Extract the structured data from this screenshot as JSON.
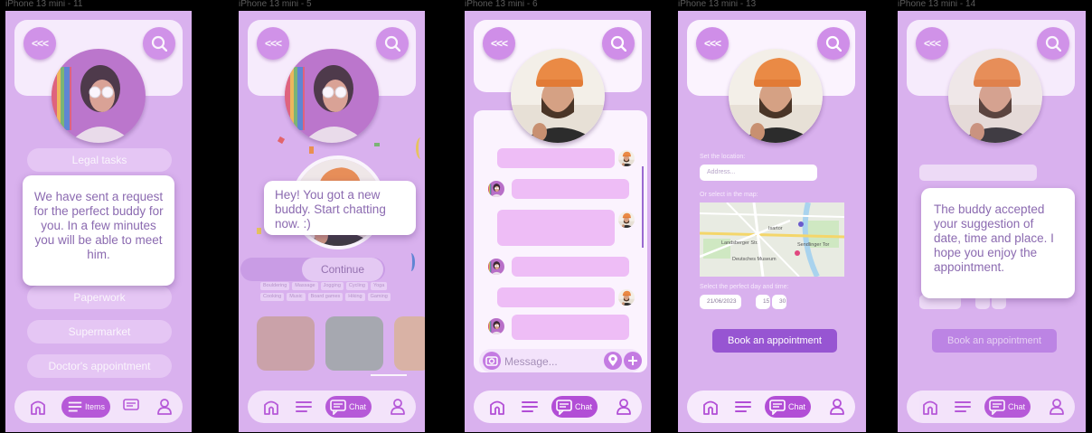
{
  "frames": [
    {
      "title": "iPhone 13 mini - 11"
    },
    {
      "title": "iPhone 13 mini - 5"
    },
    {
      "title": "iPhone 13 mini - 6"
    },
    {
      "title": "iPhone 13 mini - 13"
    },
    {
      "title": "iPhone 13 mini - 14"
    }
  ],
  "header": {
    "back_label": "<<<"
  },
  "screen1": {
    "pills": [
      "Legal tasks",
      "Paperwork",
      "Supermarket",
      "Doctor's appointment"
    ],
    "popup": "We have sent a request for the perfect buddy for you. In a few minutes you will be able to meet him.",
    "nav_active": "Items"
  },
  "screen2": {
    "popup": "Hey! You got a new buddy. Start chatting now. :)",
    "continue": "Continue",
    "tags": [
      "Bouldering",
      "Massage",
      "Jogging",
      "Cycling",
      "Yoga",
      "Cooking",
      "Music",
      "Board games",
      "Hiking",
      "Gaming"
    ],
    "nav_active": "Chat"
  },
  "screen3": {
    "message_placeholder": "Message...",
    "nav_active": "Chat"
  },
  "screen4": {
    "location_label": "Set the location:",
    "address_placeholder": "Address...",
    "map_label": "Or select in the map:",
    "map_places": [
      "Landsberger Str.",
      "Sendlinger Tor",
      "Isartor",
      "Deutsches Museum"
    ],
    "day_time_label": "Select the perfect day and time:",
    "date": "21/06/2023",
    "hour": "15",
    "minute": "30",
    "book_button": "Book an appointment",
    "nav_active": "Chat"
  },
  "screen5": {
    "popup": "The buddy accepted your suggestion of date, time and place. I hope you enjoy the appointment.",
    "book_button": "Book an appointment",
    "nav_active": "Chat"
  },
  "colors": {
    "background": "#d9b1ee",
    "accent": "#b24ed6",
    "card": "#fbf3fe",
    "popup_text": "#8b6ab0"
  }
}
